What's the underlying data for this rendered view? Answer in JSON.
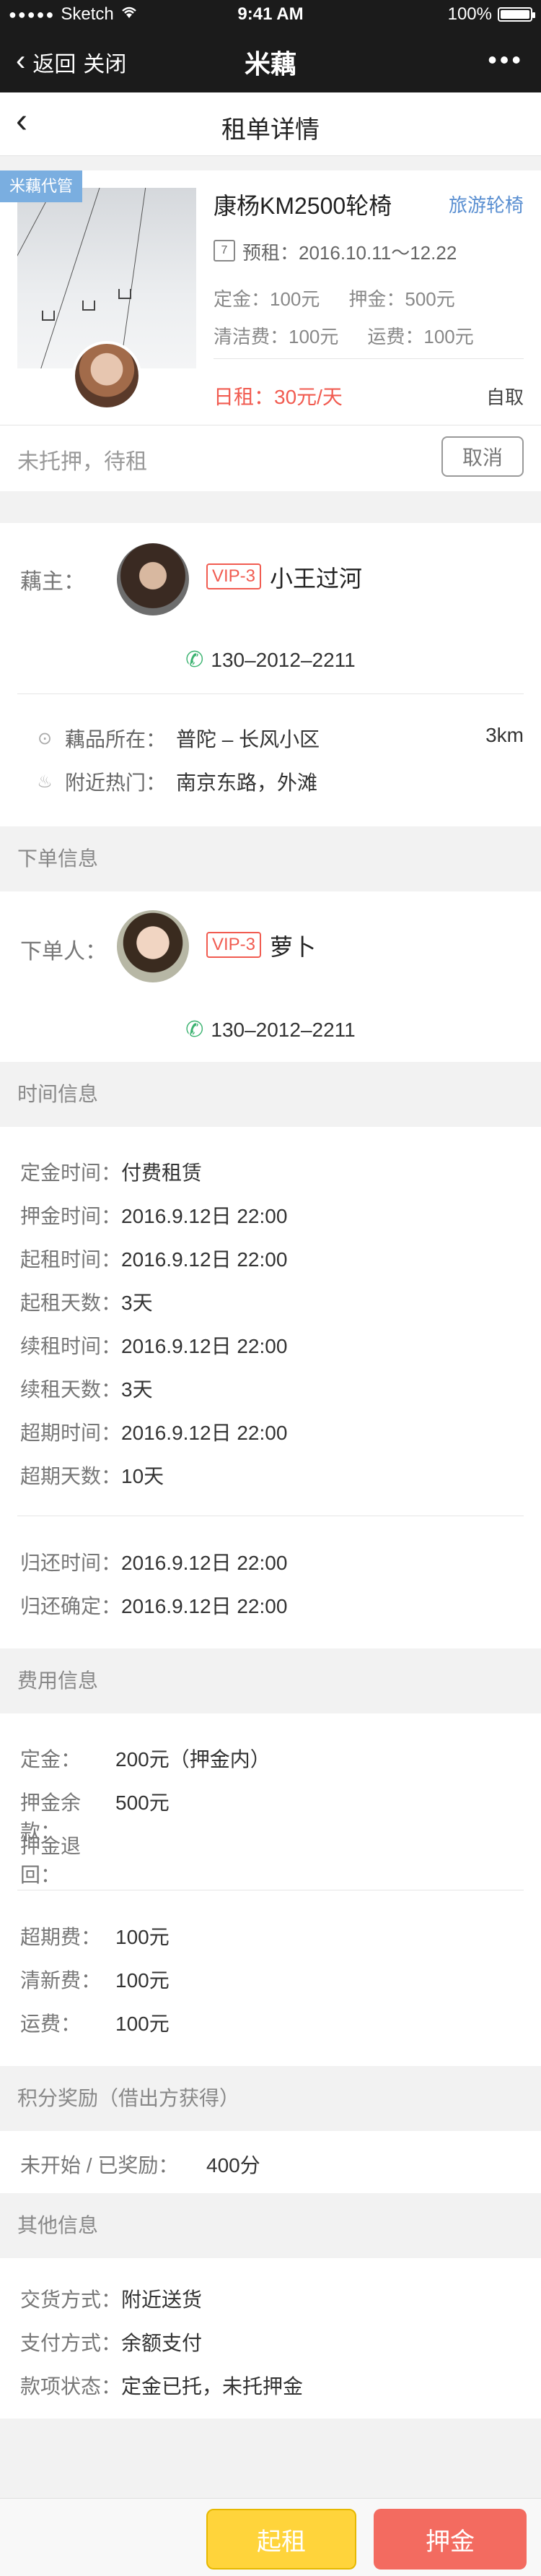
{
  "status_bar": {
    "carrier": "Sketch",
    "time": "9:41 AM",
    "battery": "100%"
  },
  "nav": {
    "back_label": "返回",
    "close_label": "关闭",
    "title": "米藕",
    "more": "•••"
  },
  "page": {
    "title": "租单详情"
  },
  "order": {
    "badge": "米藕代管",
    "product_title": "康杨KM2500轮椅",
    "product_tag": "旅游轮椅",
    "cal_day": "7",
    "period_label": "预租：",
    "period": "2016.10.11～12.22",
    "deposit_fixed": "定金：100元",
    "deposit": "押金：500元",
    "cleaning": "清洁费：100元",
    "shipping": "运费：100元",
    "daily_rent": "日租：30元/天",
    "pickup": "自取",
    "status": "未托押，待租",
    "cancel": "取消"
  },
  "owner": {
    "label": "藕主：",
    "vip": "VIP-3",
    "name": "小王过河",
    "phone": "130–2012–2211",
    "location_label": "藕品所在：",
    "location": "普陀 – 长风小区",
    "distance": "3km",
    "hot_label": "附近热门：",
    "hot": "南京东路，外滩"
  },
  "order_info": {
    "section": "下单信息",
    "label": "下单人：",
    "vip": "VIP-3",
    "name": "萝卜",
    "phone": "130–2012–2211"
  },
  "time_info": {
    "section": "时间信息",
    "rows": [
      {
        "k": "定金时间：",
        "v": "付费租赁"
      },
      {
        "k": "押金时间：",
        "v": "2016.9.12日 22:00"
      },
      {
        "k": "起租时间：",
        "v": "2016.9.12日 22:00"
      },
      {
        "k": "起租天数：",
        "v": "3天"
      },
      {
        "k": "续租时间：",
        "v": "2016.9.12日 22:00"
      },
      {
        "k": "续租天数：",
        "v": "3天"
      },
      {
        "k": "超期时间：",
        "v": "2016.9.12日 22:00"
      },
      {
        "k": "超期天数：",
        "v": "10天"
      },
      {
        "k": "归还时间：",
        "v": "2016.9.12日 22:00"
      },
      {
        "k": "归还确定：",
        "v": "2016.9.12日 22:00"
      }
    ]
  },
  "fee_info": {
    "section": "费用信息",
    "rows": [
      {
        "k": "定金：",
        "v": "200元（押金内）"
      },
      {
        "k": "押金余款：",
        "v": "500元"
      },
      {
        "k": "押金退回：",
        "v": ""
      },
      {
        "k": "超期费：",
        "v": "100元"
      },
      {
        "k": "清新费：",
        "v": "100元"
      },
      {
        "k": "运费：",
        "v": "100元"
      }
    ]
  },
  "points": {
    "section": "积分奖励（借出方获得）",
    "k": "未开始 / 已奖励：",
    "v": "400分"
  },
  "other": {
    "section": "其他信息",
    "rows": [
      {
        "k": "交货方式：",
        "v": "附近送货"
      },
      {
        "k": "支付方式：",
        "v": "余额支付"
      },
      {
        "k": "款项状态：",
        "v": "定金已托，未托押金"
      }
    ]
  },
  "actions": {
    "start": "起租",
    "deposit": "押金"
  },
  "colors": {
    "accent_red": "#f15b50",
    "accent_yellow": "#ffd43b",
    "link_blue": "#5a8fd1",
    "phone_green": "#3cb371"
  }
}
